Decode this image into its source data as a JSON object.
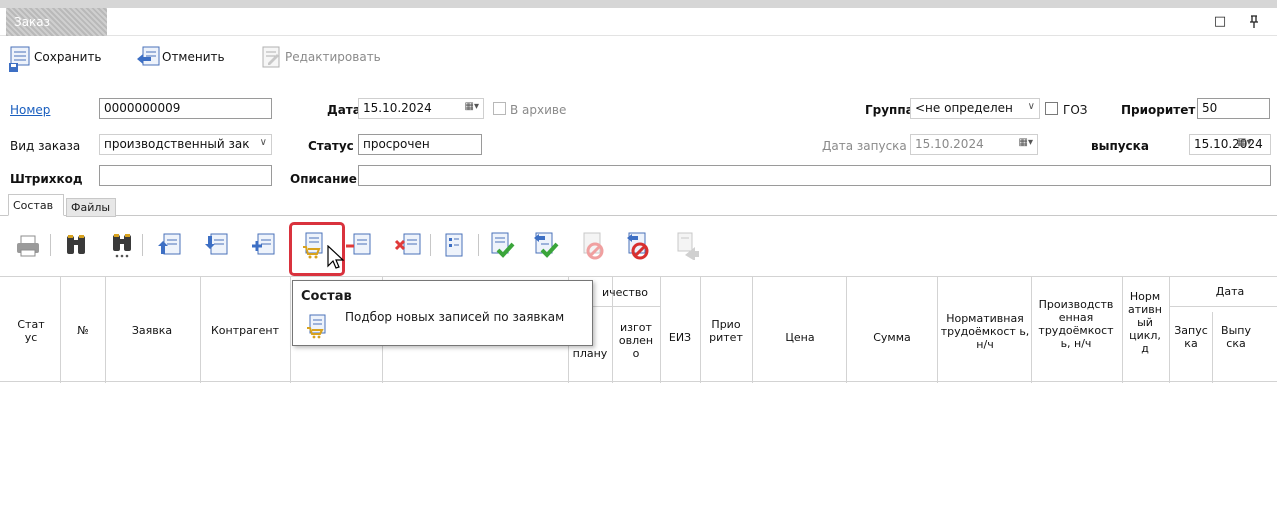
{
  "window": {
    "title": "Заказ",
    "restore_icon": "□",
    "pin_icon": "ꟼ"
  },
  "toolbar": {
    "save_label": "Сохранить",
    "cancel_label": "Отменить",
    "edit_label": "Редактировать"
  },
  "form": {
    "number_label": "Номер",
    "number_value": "0000000009",
    "date_label": "Дата",
    "date_value": "15.10.2024",
    "archive_label": "В архиве",
    "group_label": "Группа",
    "group_value": "<не определен",
    "goz_label": "ГОЗ",
    "priority_label": "Приоритет",
    "priority_value": "50",
    "order_type_label": "Вид заказа",
    "order_type_value": "производственный зак",
    "status_label": "Статус",
    "status_value": "просрочен",
    "launch_date_label": "Дата запуска",
    "launch_date_value": "15.10.2024",
    "release_label": "выпуска",
    "release_value": "15.10.2024",
    "barcode_label": "Штрихкод",
    "barcode_value": "",
    "description_label": "Описание",
    "description_value": ""
  },
  "tabs": {
    "composition": "Состав",
    "files": "Файлы"
  },
  "grid": {
    "col_status": "Стат ус",
    "col_number": "№",
    "col_request": "Заявка",
    "col_contractor": "Контрагент",
    "col_quantity_group": "ичество",
    "col_plan": "плану",
    "col_made": "изгот овлен о",
    "col_unit": "ЕИЗ",
    "col_priority": "Прио ритет",
    "col_price": "Цена",
    "col_sum": "Сумма",
    "col_norm_labor": "Нормативная трудоёмкост ь, н/ч",
    "col_prod_labor": "Производств енная трудоёмкост ь, н/ч",
    "col_norm_cycle": "Норм ативн ый цикл, д",
    "col_date_group": "Дата",
    "col_launch": "Запус ка",
    "col_release": "Выпу ска"
  },
  "tooltip": {
    "title": "Состав",
    "text": "Подбор новых записей по заявкам"
  },
  "colors": {
    "highlight": "#d9323d",
    "link": "#1a5fbf",
    "green_check": "#3aa53a",
    "red_icon": "#e03a3a"
  }
}
